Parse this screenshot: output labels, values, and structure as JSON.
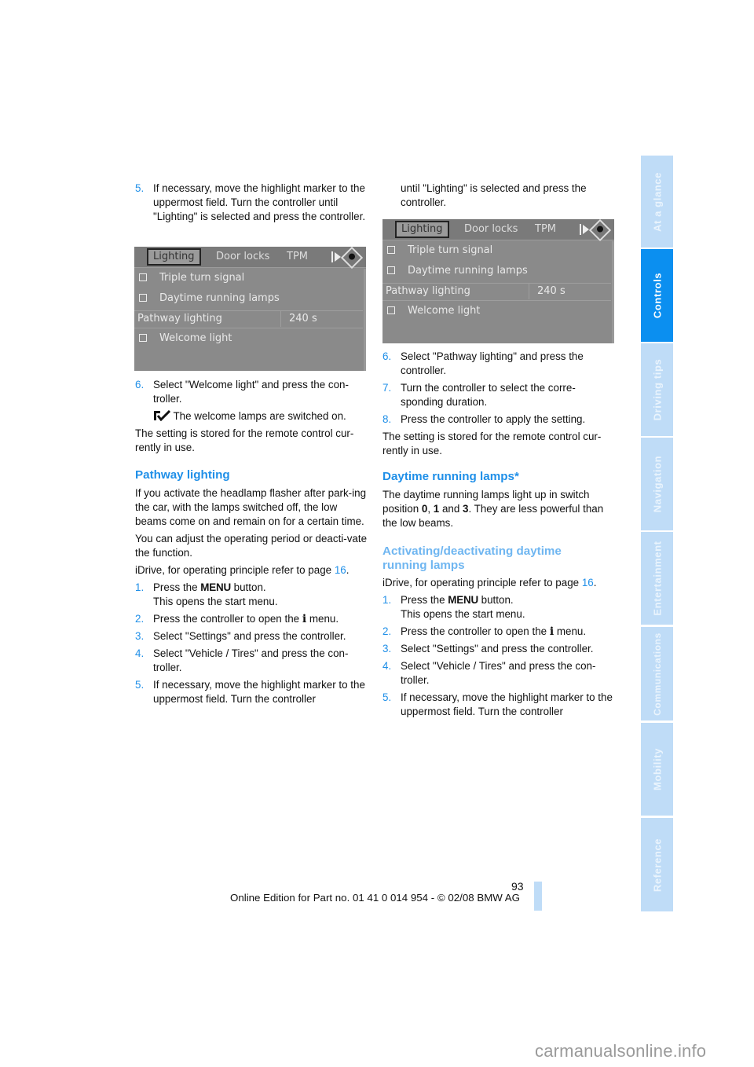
{
  "page": {
    "number": "93",
    "footer": "Online Edition for Part no. 01 41 0 014 954  - © 02/08 BMW AG",
    "watermark": "carmanualsonline.info"
  },
  "side_tabs": [
    {
      "label": "At a glance",
      "active": false
    },
    {
      "label": "Controls",
      "active": true
    },
    {
      "label": "Driving tips",
      "active": false
    },
    {
      "label": "Navigation",
      "active": false
    },
    {
      "label": "Entertainment",
      "active": false
    },
    {
      "label": "Communications",
      "active": false
    },
    {
      "label": "Mobility",
      "active": false
    },
    {
      "label": "Reference",
      "active": false
    }
  ],
  "screen": {
    "tabs": [
      "Lighting",
      "Door locks",
      "TPM"
    ],
    "selected_tab": "Lighting",
    "rows": [
      {
        "label": "Triple turn signal",
        "type": "checkbox",
        "checked": false
      },
      {
        "label": "Daytime running lamps",
        "type": "checkbox",
        "checked": false
      },
      {
        "label": "Pathway lighting",
        "type": "value",
        "value": "240 s"
      },
      {
        "label": "Welcome light",
        "type": "checkbox",
        "checked": false
      }
    ]
  },
  "left": {
    "step5": {
      "num": "5.",
      "text": "If necessary, move the highlight marker to the uppermost field. Turn the controller until \"Lighting\" is selected and press the controller."
    },
    "step6": {
      "num": "6.",
      "text": "Select \"Welcome light\" and press the con-troller."
    },
    "check_note": "The welcome lamps are switched on.",
    "stored": "The setting is stored for the remote control cur-rently in use.",
    "pathway_heading": "Pathway lighting",
    "pathway_p1": "If you activate the headlamp flasher after park-ing the car, with the lamps switched off, the low beams come on and remain on for a certain time.",
    "pathway_p2": "You can adjust the operating period or deacti-vate the function.",
    "idrive_prefix": "iDrive, for operating principle refer to page ",
    "idrive_page": "16",
    "idrive_suffix": ".",
    "steps": [
      {
        "num": "1.",
        "pre": "Press the ",
        "menu": "MENU",
        "post": " button.",
        "line2": "This opens the start menu."
      },
      {
        "num": "2.",
        "pre": "Press the controller to open the ",
        "icon": "i",
        "post": " menu."
      },
      {
        "num": "3.",
        "text": "Select \"Settings\" and press the controller."
      },
      {
        "num": "4.",
        "text": "Select \"Vehicle / Tires\" and press the con-troller."
      },
      {
        "num": "5.",
        "text": "If necessary, move the highlight marker to the uppermost field. Turn the controller"
      }
    ]
  },
  "right": {
    "cont": "until \"Lighting\" is selected and press the controller.",
    "steps_a": [
      {
        "num": "6.",
        "text": "Select \"Pathway lighting\" and press the controller."
      },
      {
        "num": "7.",
        "text": "Turn the controller to select the corre-sponding duration."
      },
      {
        "num": "8.",
        "text": "Press the controller to apply the setting."
      }
    ],
    "stored": "The setting is stored for the remote control cur-rently in use.",
    "drl_heading": "Daytime running lamps*",
    "drl_p_pre": "The daytime running lamps light up in switch position ",
    "drl_pos0": "0",
    "drl_sep1": ", ",
    "drl_pos1": "1",
    "drl_sep2": " and ",
    "drl_pos3": "3",
    "drl_p_post": ". They are less powerful than the low beams.",
    "act_heading": "Activating/deactivating daytime running lamps",
    "idrive_prefix": "iDrive, for operating principle refer to page ",
    "idrive_page": "16",
    "idrive_suffix": ".",
    "steps": [
      {
        "num": "1.",
        "pre": "Press the ",
        "menu": "MENU",
        "post": " button.",
        "line2": "This opens the start menu."
      },
      {
        "num": "2.",
        "pre": "Press the controller to open the ",
        "icon": "i",
        "post": " menu."
      },
      {
        "num": "3.",
        "text": "Select \"Settings\" and press the controller."
      },
      {
        "num": "4.",
        "text": "Select \"Vehicle / Tires\" and press the con-troller."
      },
      {
        "num": "5.",
        "text": "If necessary, move the highlight marker to the uppermost field. Turn the controller"
      }
    ]
  }
}
